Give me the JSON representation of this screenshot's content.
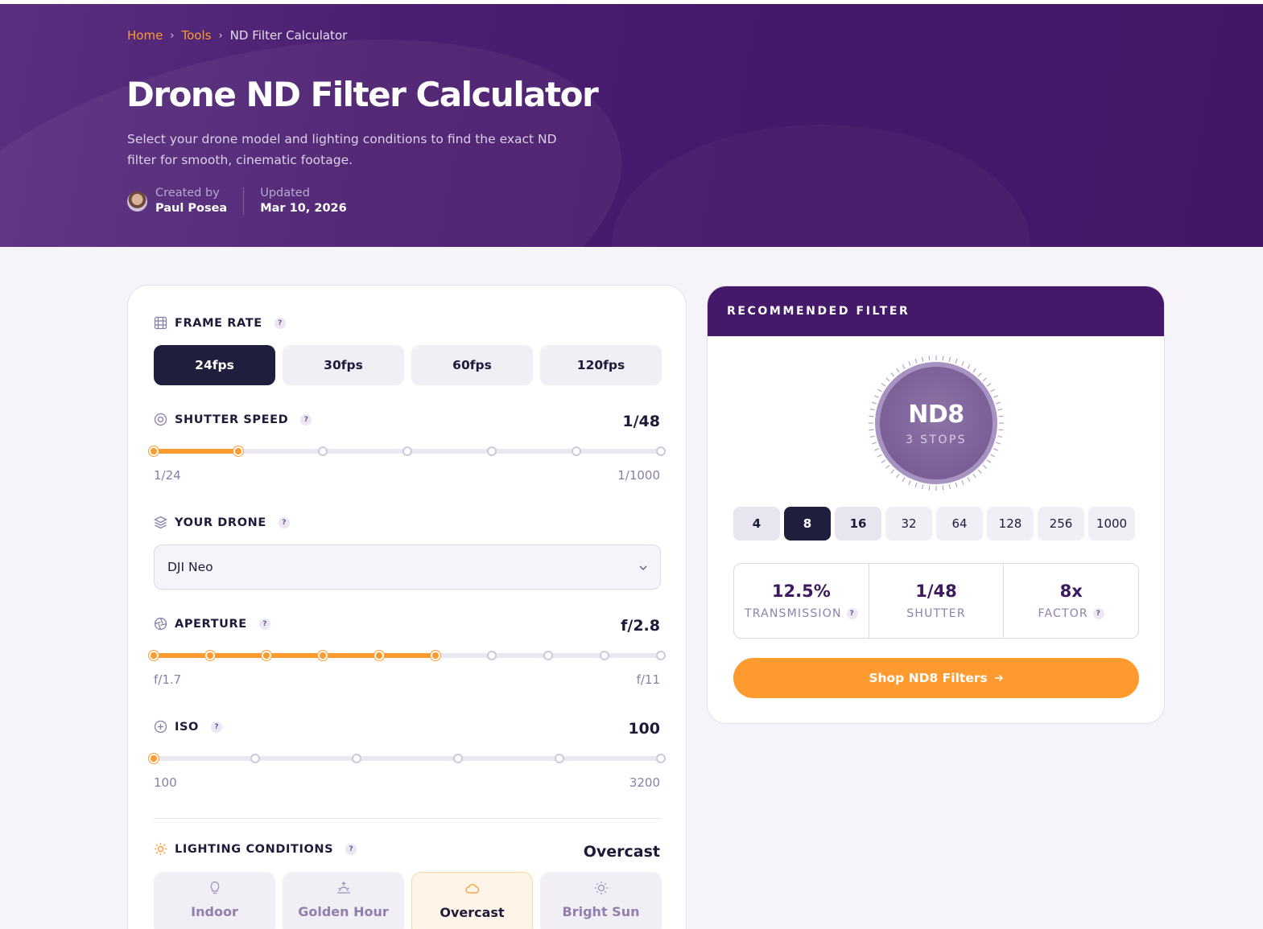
{
  "breadcrumb": {
    "home": "Home",
    "tools": "Tools",
    "current": "ND Filter Calculator"
  },
  "hero": {
    "title": "Drone ND Filter Calculator",
    "description": "Select your drone model and lighting conditions to find the exact ND filter for smooth, cinematic footage.",
    "created_label": "Created by",
    "author": "Paul Posea",
    "updated_label": "Updated",
    "updated_date": "Mar 10, 2026"
  },
  "frame_rate": {
    "title": "FRAME RATE",
    "options": [
      "24fps",
      "30fps",
      "60fps",
      "120fps"
    ],
    "selected_index": 0
  },
  "shutter": {
    "title": "SHUTTER SPEED",
    "value": "1/48",
    "min_label": "1/24",
    "max_label": "1/1000",
    "steps": 7,
    "selected_step": 1
  },
  "drone": {
    "title": "YOUR DRONE",
    "selected": "DJI Neo"
  },
  "aperture": {
    "title": "APERTURE",
    "value": "f/2.8",
    "min_label": "f/1.7",
    "max_label": "f/11",
    "steps": 10,
    "selected_step": 5
  },
  "iso": {
    "title": "ISO",
    "value": "100",
    "min_label": "100",
    "max_label": "3200",
    "steps": 6,
    "selected_step": 0
  },
  "lighting": {
    "title": "LIGHTING CONDITIONS",
    "value": "Overcast",
    "options": [
      {
        "label": "Indoor",
        "icon": "lightbulb-icon"
      },
      {
        "label": "Golden Hour",
        "icon": "sunset-icon"
      },
      {
        "label": "Overcast",
        "icon": "cloud-icon"
      },
      {
        "label": "Bright Sun",
        "icon": "sun-icon"
      }
    ],
    "selected_index": 2
  },
  "recommended": {
    "header": "RECOMMENDED FILTER",
    "badge_main": "ND8",
    "badge_sub": "3 STOPS",
    "nd_options": [
      "4",
      "8",
      "16",
      "32",
      "64",
      "128",
      "256",
      "1000"
    ],
    "selected_index": 1,
    "stats": [
      {
        "value": "12.5%",
        "label": "TRANSMISSION",
        "help": true
      },
      {
        "value": "1/48",
        "label": "SHUTTER",
        "help": false
      },
      {
        "value": "8x",
        "label": "FACTOR",
        "help": true
      }
    ],
    "shop_label": "Shop ND8 Filters",
    "help_glyph": "?"
  },
  "colors": {
    "hero_purple": "#45196a",
    "accent_orange": "#ff9a2e",
    "dark_navy": "#1f1e3d"
  }
}
